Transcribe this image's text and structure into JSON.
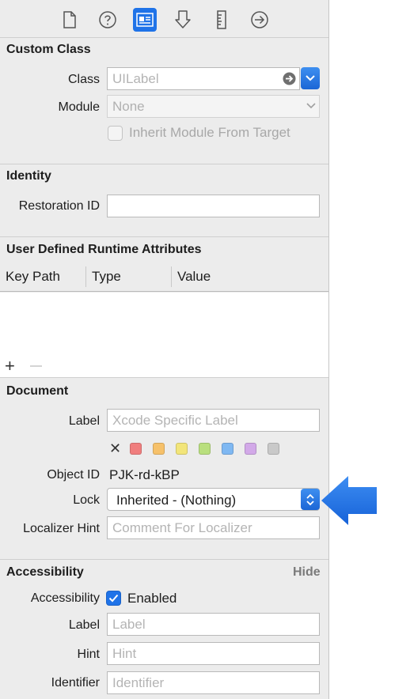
{
  "toolbar": {
    "tabs": [
      {
        "icon": "file-icon"
      },
      {
        "icon": "help-icon"
      },
      {
        "icon": "identity-inspector-icon",
        "active": true
      },
      {
        "icon": "attributes-icon"
      },
      {
        "icon": "size-ruler-icon"
      },
      {
        "icon": "connections-arrow-icon"
      }
    ]
  },
  "custom_class": {
    "header": "Custom Class",
    "class_label": "Class",
    "class_placeholder": "UILabel",
    "module_label": "Module",
    "module_placeholder": "None",
    "inherit_label": "Inherit Module From Target"
  },
  "identity": {
    "header": "Identity",
    "restoration_label": "Restoration ID",
    "restoration_value": ""
  },
  "runtime_attributes": {
    "header": "User Defined Runtime Attributes",
    "columns": [
      "Key Path",
      "Type",
      "Value"
    ],
    "add_symbol": "+",
    "remove_symbol": "—"
  },
  "document": {
    "header": "Document",
    "label_label": "Label",
    "label_placeholder": "Xcode Specific Label",
    "clear_symbol": "✕",
    "swatches": [
      "#f07e7e",
      "#f6c16a",
      "#f2e57a",
      "#b9df7e",
      "#7fb8f2",
      "#d2a9e8",
      "#c9c9c9"
    ],
    "object_id_label": "Object ID",
    "object_id_value": "PJK-rd-kBP",
    "lock_label": "Lock",
    "lock_value": "Inherited - (Nothing)",
    "localizer_label": "Localizer Hint",
    "localizer_placeholder": "Comment For Localizer"
  },
  "accessibility": {
    "header": "Accessibility",
    "hide_label": "Hide",
    "accessibility_label": "Accessibility",
    "enabled_label": "Enabled",
    "enabled_checked": true,
    "label_label": "Label",
    "label_placeholder": "Label",
    "hint_label": "Hint",
    "hint_placeholder": "Hint",
    "identifier_label": "Identifier",
    "identifier_placeholder": "Identifier"
  },
  "colors": {
    "accent": "#1f73e8",
    "callout_arrow": "#1c6fe6"
  }
}
